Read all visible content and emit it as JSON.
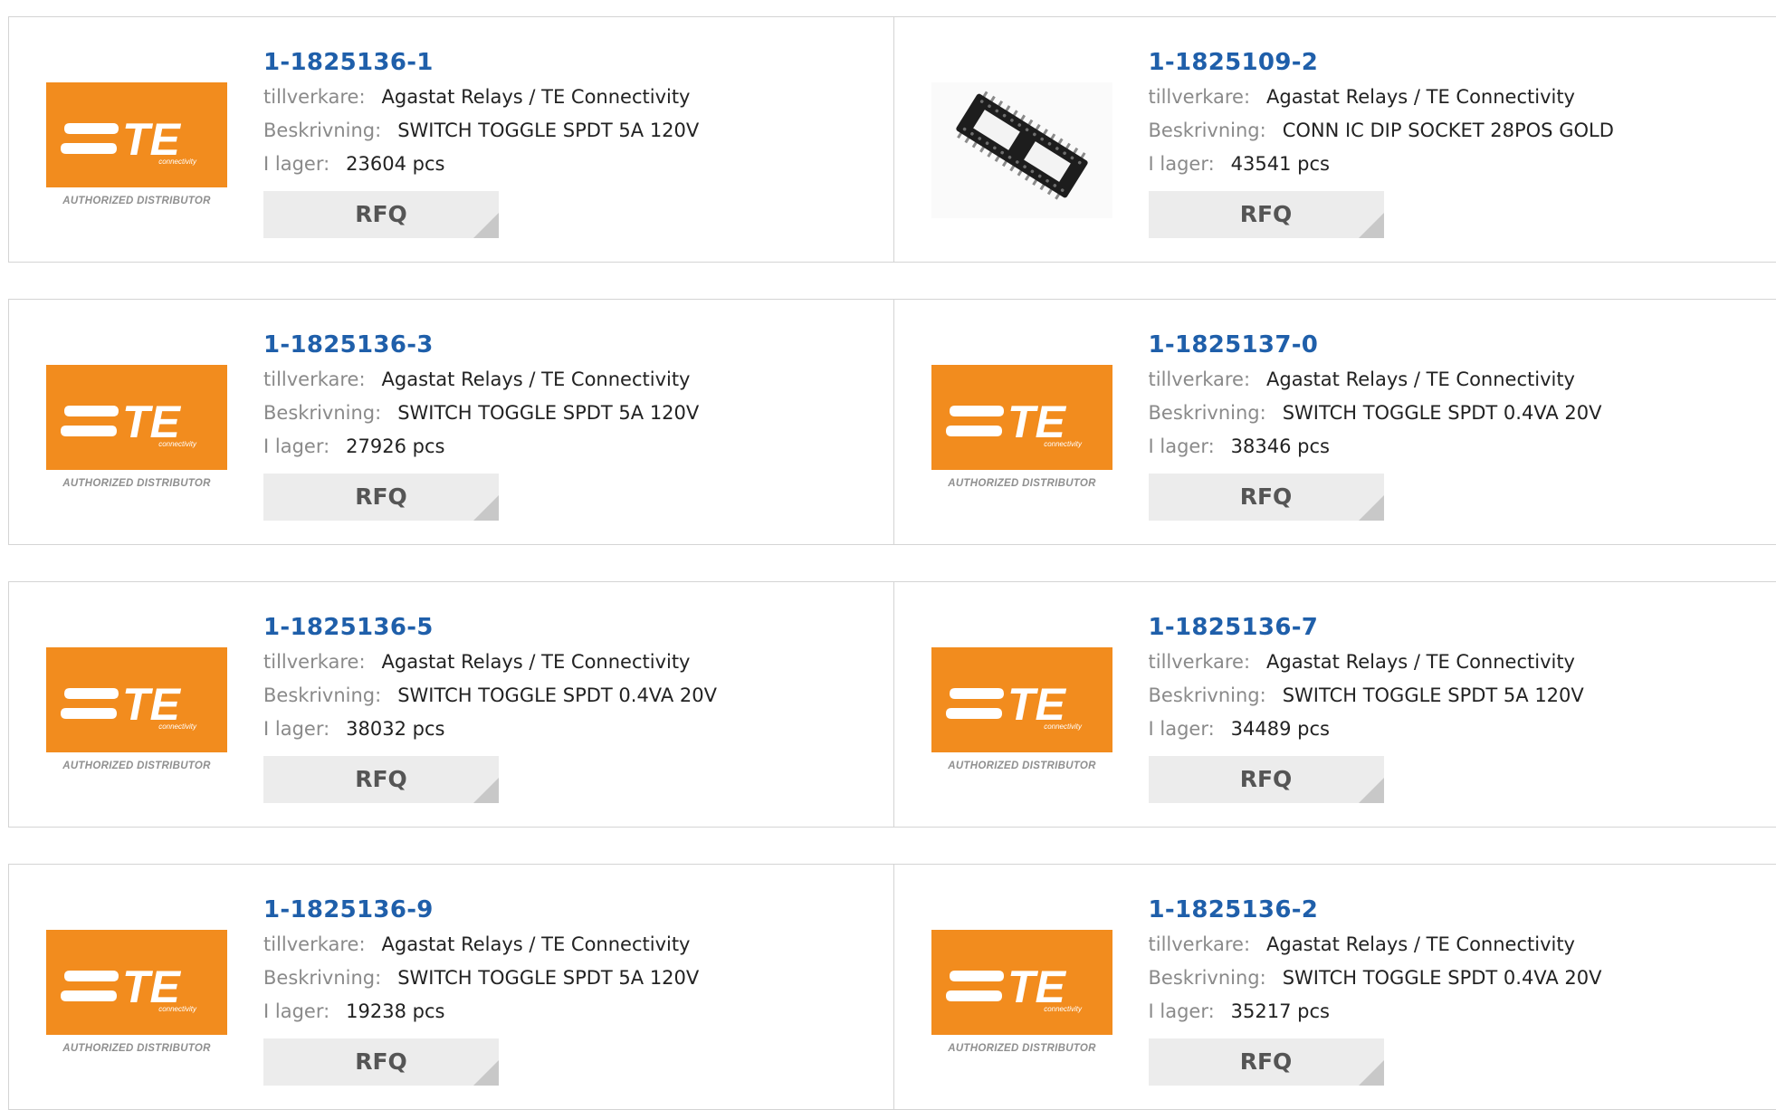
{
  "labels": {
    "manufacturer": "tillverkare:",
    "description": "Beskrivning:",
    "stock": "I lager:",
    "rfq": "RFQ"
  },
  "brand": {
    "logo_text": "TE",
    "logo_subtext": "connectivity",
    "logo_caption": "AUTHORIZED DISTRIBUTOR",
    "orange": "#F28C1E"
  },
  "products": [
    {
      "part": "1-1825136-1",
      "manufacturer": "Agastat Relays / TE Connectivity",
      "description": "SWITCH TOGGLE SPDT 5A 120V",
      "stock": "23604 pcs",
      "image": "te-logo"
    },
    {
      "part": "1-1825109-2",
      "manufacturer": "Agastat Relays / TE Connectivity",
      "description": "CONN IC DIP SOCKET 28POS GOLD",
      "stock": "43541 pcs",
      "image": "dip-socket"
    },
    {
      "part": "1-1825136-3",
      "manufacturer": "Agastat Relays / TE Connectivity",
      "description": "SWITCH TOGGLE SPDT 5A 120V",
      "stock": "27926 pcs",
      "image": "te-logo"
    },
    {
      "part": "1-1825137-0",
      "manufacturer": "Agastat Relays / TE Connectivity",
      "description": "SWITCH TOGGLE SPDT 0.4VA 20V",
      "stock": "38346 pcs",
      "image": "te-logo"
    },
    {
      "part": "1-1825136-5",
      "manufacturer": "Agastat Relays / TE Connectivity",
      "description": "SWITCH TOGGLE SPDT 0.4VA 20V",
      "stock": "38032 pcs",
      "image": "te-logo"
    },
    {
      "part": "1-1825136-7",
      "manufacturer": "Agastat Relays / TE Connectivity",
      "description": "SWITCH TOGGLE SPDT 5A 120V",
      "stock": "34489 pcs",
      "image": "te-logo"
    },
    {
      "part": "1-1825136-9",
      "manufacturer": "Agastat Relays / TE Connectivity",
      "description": "SWITCH TOGGLE SPDT 5A 120V",
      "stock": "19238 pcs",
      "image": "te-logo"
    },
    {
      "part": "1-1825136-2",
      "manufacturer": "Agastat Relays / TE Connectivity",
      "description": "SWITCH TOGGLE SPDT 0.4VA 20V",
      "stock": "35217 pcs",
      "image": "te-logo"
    }
  ]
}
